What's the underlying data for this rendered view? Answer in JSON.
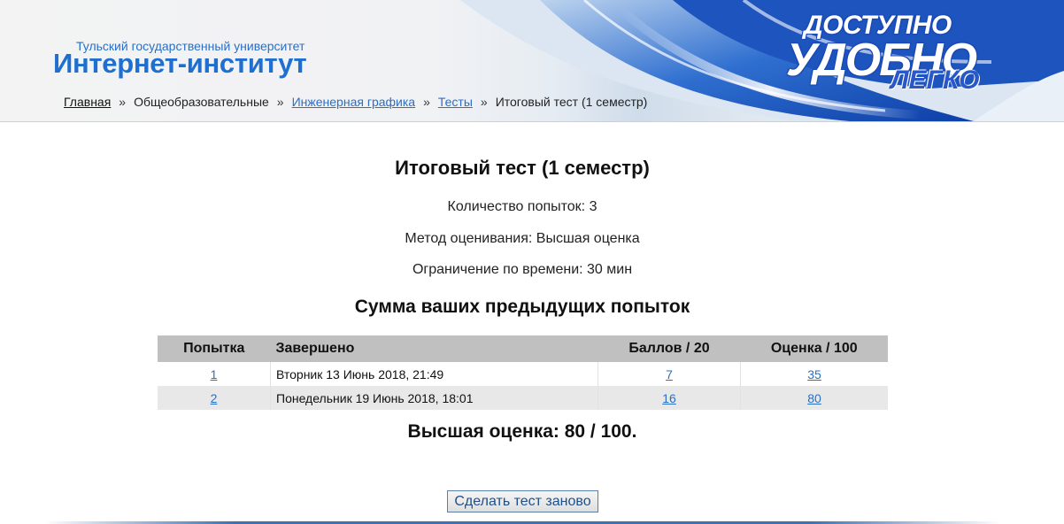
{
  "header": {
    "university": "Тульский государственный университет",
    "institute": "Интернет-институт",
    "slogan": [
      "ДОСТУПНО",
      "УДОБНО",
      "ЛЕГКО"
    ]
  },
  "breadcrumb": {
    "items": [
      "Главная",
      "Общеобразовательные",
      "Инженерная графика",
      "Тесты",
      "Итоговый тест (1 семестр)"
    ],
    "separator": "»"
  },
  "quiz": {
    "title": "Итоговый тест (1 семестр)",
    "attempts_allowed": "Количество попыток: 3",
    "grading_method": "Метод оценивания: Высшая оценка",
    "time_limit": "Ограничение по времени: 30 мин"
  },
  "summary": {
    "title": "Сумма ваших предыдущих попыток",
    "columns": [
      "Попытка",
      "Завершено",
      "Баллов / 20",
      "Оценка / 100"
    ],
    "rows": [
      {
        "attempt": "1",
        "completed": "Вторник 13 Июнь 2018, 21:49",
        "points": "7",
        "grade": "35"
      },
      {
        "attempt": "2",
        "completed": "Понедельник 19 Июнь 2018, 18:01",
        "points": "16",
        "grade": "80"
      }
    ]
  },
  "best_grade": "Высшая оценка: 80 / 100.",
  "retake_button": "Сделать тест заново",
  "colors": {
    "link": "#2a6fc4",
    "header_gray": "#c0c0c0",
    "brand_blue": "#1e6fcf"
  }
}
